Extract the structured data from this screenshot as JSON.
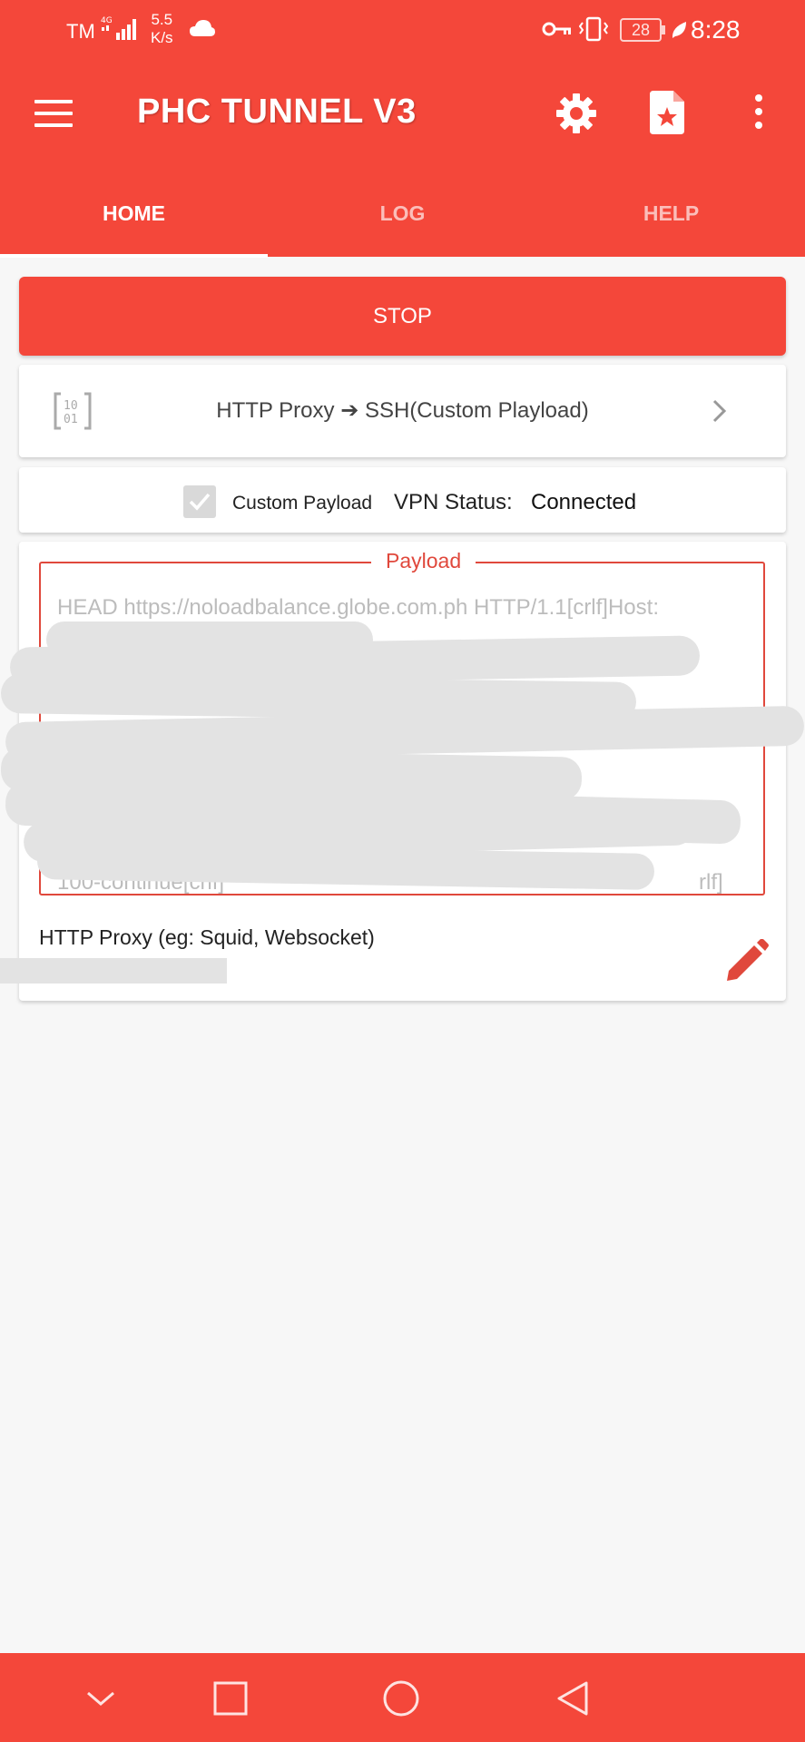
{
  "status_bar": {
    "carrier": "TM",
    "speed_value": "5.5",
    "speed_unit": "K/s",
    "battery": "28",
    "time": "8:28"
  },
  "app_bar": {
    "title": "PHC TUNNEL V3",
    "icons": [
      "menu-icon",
      "gear-icon",
      "file-star-icon",
      "more-vertical-icon"
    ]
  },
  "tabs": [
    {
      "label": "HOME",
      "active": true
    },
    {
      "label": "LOG",
      "active": false
    },
    {
      "label": "HELP",
      "active": false
    }
  ],
  "stop_button": {
    "label": "STOP"
  },
  "mode": {
    "label": "HTTP Proxy ➔ SSH(Custom Playload)"
  },
  "status": {
    "custom_payload_label": "Custom Payload",
    "custom_payload_checked": true,
    "vpn_status_label": "VPN Status:",
    "vpn_status_value": "Connected"
  },
  "payload": {
    "legend": "Payload",
    "text": "HEAD https://noloadbalance.globe.com.ph HTTP/1.1[crlf]Host:",
    "last_line": "100-continue[crlf]",
    "last_line_end": "rlf]"
  },
  "proxy": {
    "label": "HTTP Proxy (eg: Squid, Websocket)"
  },
  "colors": {
    "primary": "#f4473a",
    "accent_border": "#e0483c",
    "background": "#f7f7f7"
  }
}
